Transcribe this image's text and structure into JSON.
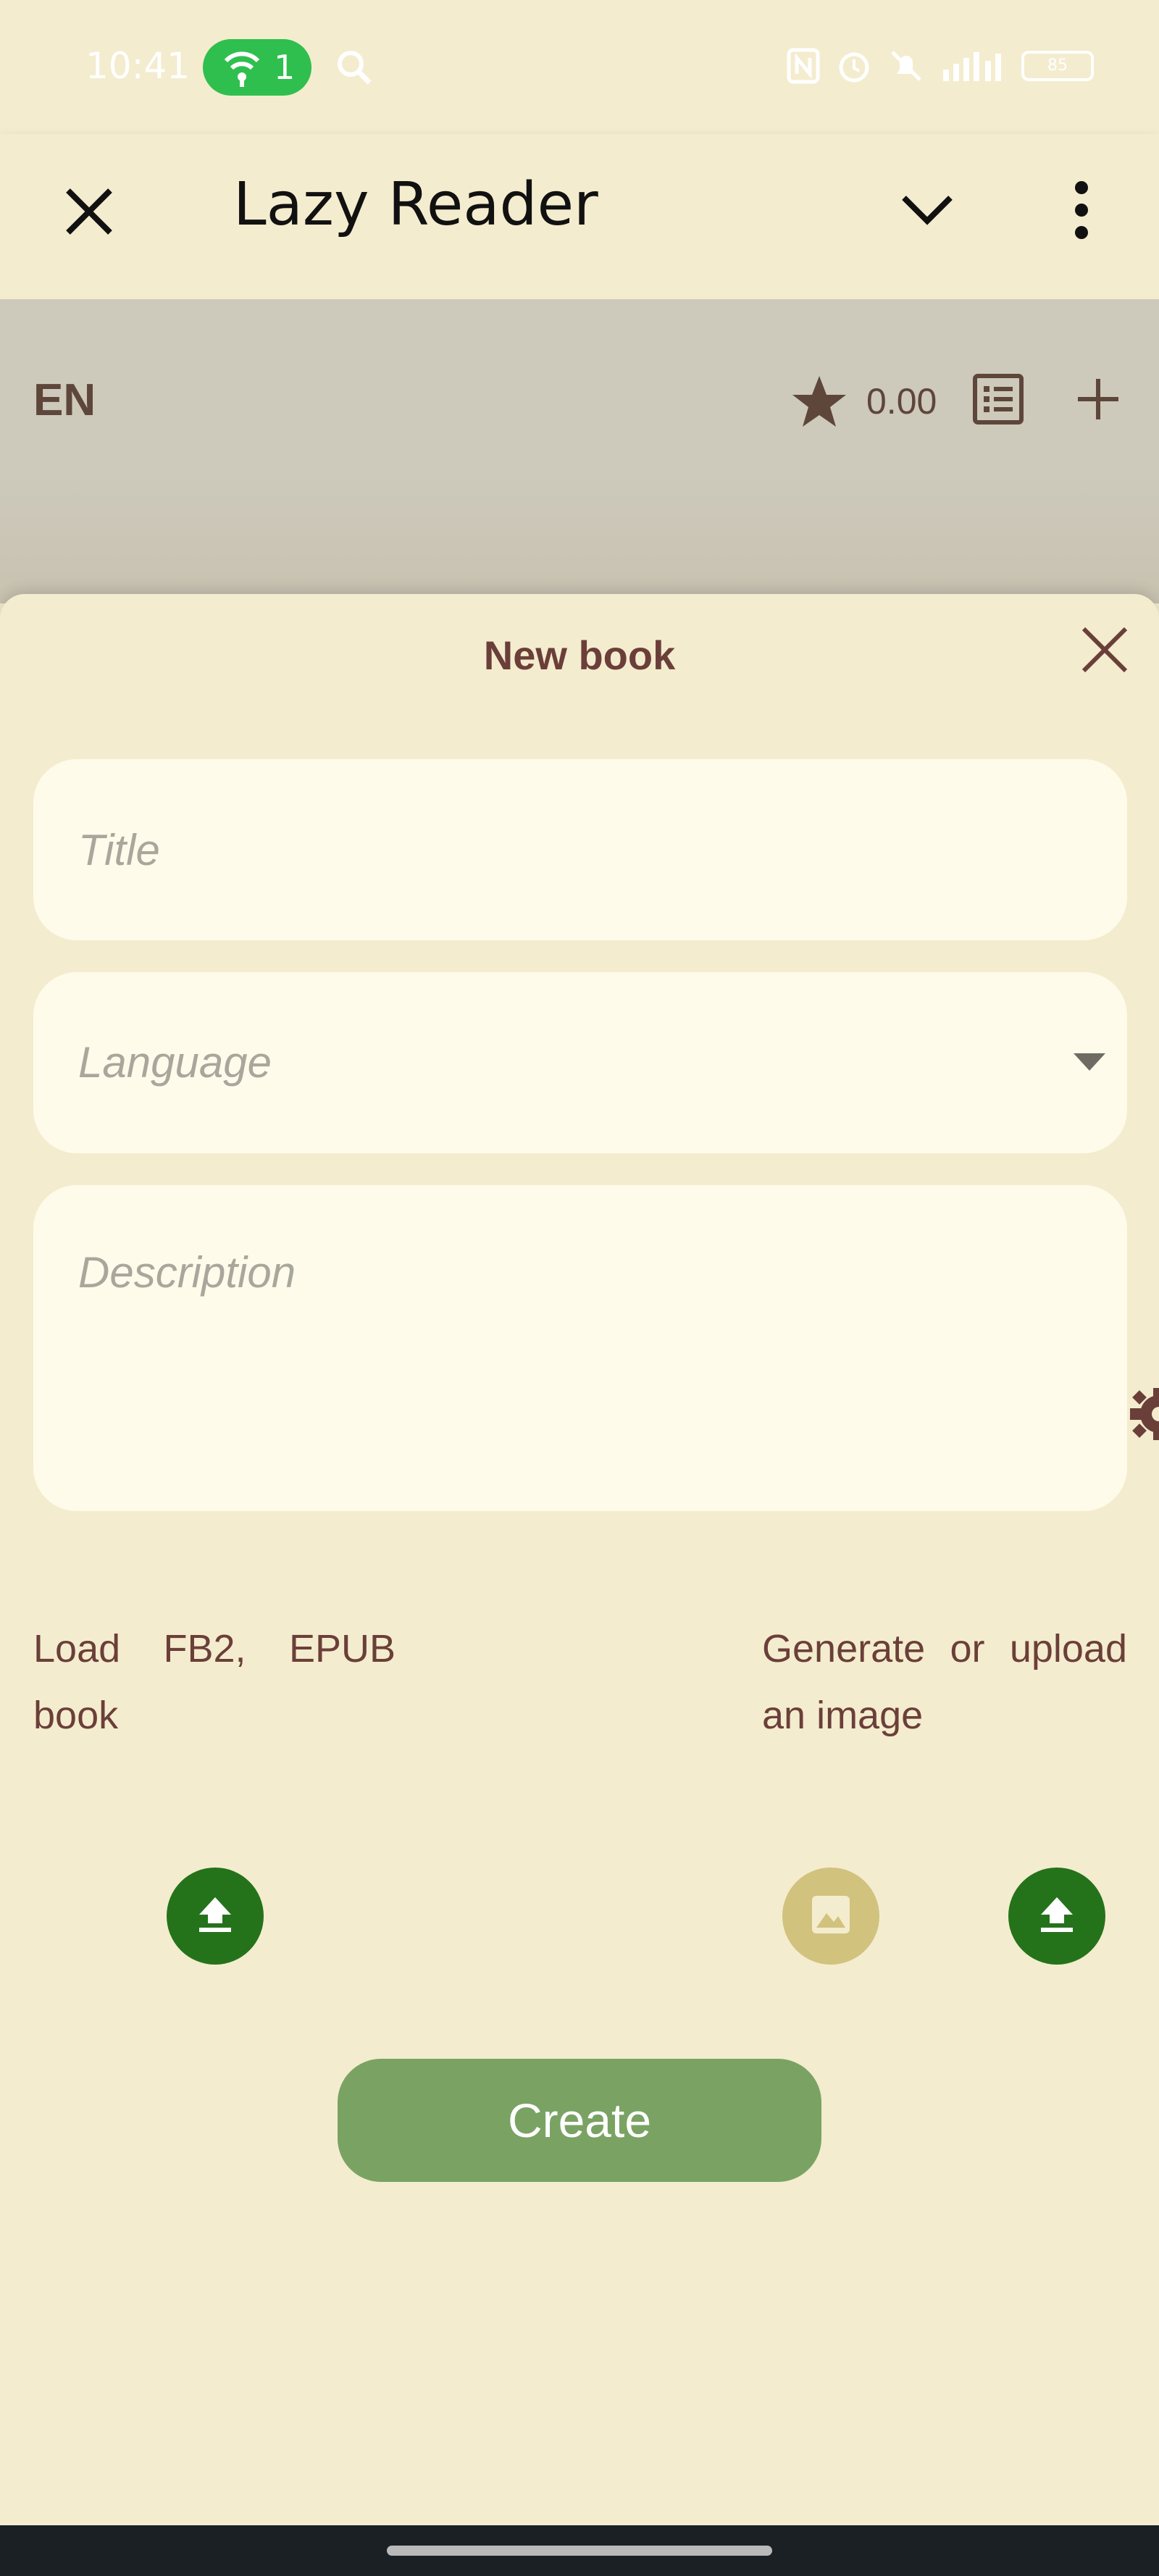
{
  "status_bar": {
    "time": "10:41",
    "hotspot_count": "1",
    "battery": "85",
    "icons": [
      "wifi-hotspot-icon",
      "search-icon",
      "nfc-icon",
      "alarm-icon",
      "mute-icon",
      "signal-icon",
      "battery-icon"
    ]
  },
  "app_bar": {
    "title": "Lazy Reader",
    "icons": [
      "close-icon",
      "chevron-down-icon",
      "more-vert-icon"
    ]
  },
  "sub_bar": {
    "language": "EN",
    "score": "0.00",
    "icons": [
      "star-icon",
      "list-icon",
      "plus-icon"
    ]
  },
  "sheet": {
    "title": "New book",
    "title_placeholder": "Title",
    "language_placeholder": "Language",
    "description_placeholder": "Description",
    "load_book_label": "Load FB2, EPUB book",
    "image_label": "Generate or upload an image",
    "create_label": "Create"
  },
  "colors": {
    "background": "#f4ecce",
    "field": "#fffbeb",
    "accent_text": "#6b3f39",
    "green_button": "#24731b",
    "create_button": "#7aa363",
    "image_button": "#d1c27e"
  }
}
